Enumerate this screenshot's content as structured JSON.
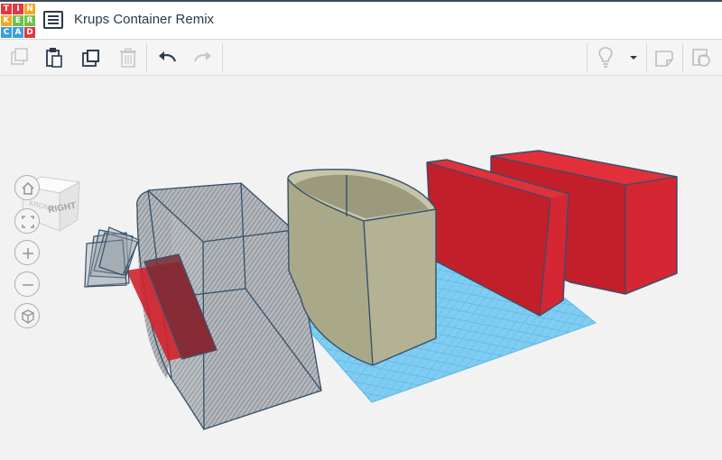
{
  "app": {
    "logo_letters": [
      "T",
      "I",
      "N",
      "K",
      "E",
      "R",
      "C",
      "A",
      "D"
    ],
    "logo_colors": [
      "#e2383f",
      "#e2383f",
      "#f5a623",
      "#f5a623",
      "#6fc04b",
      "#6fc04b",
      "#3d9fd9",
      "#3d9fd9",
      "#e2383f"
    ],
    "design_title": "Krups Container Remix",
    "design_list_icon": "list-icon"
  },
  "toolbar": {
    "buttons": [
      {
        "name": "copy",
        "icon": "copy-icon",
        "enabled": false
      },
      {
        "name": "paste",
        "icon": "paste-icon",
        "enabled": true
      },
      {
        "name": "duplicate",
        "icon": "duplicate-icon",
        "enabled": true
      },
      {
        "name": "delete",
        "icon": "trash-icon",
        "enabled": false
      },
      {
        "name": "undo",
        "icon": "undo-arrow-icon",
        "enabled": true
      },
      {
        "name": "redo",
        "icon": "redo-arrow-icon",
        "enabled": false
      },
      {
        "name": "light",
        "icon": "lightbulb-icon",
        "enabled": false
      },
      {
        "name": "light-menu",
        "icon": "caret-down-icon",
        "enabled": true
      },
      {
        "name": "note",
        "icon": "note-icon",
        "enabled": false
      },
      {
        "name": "ruler",
        "icon": "ruler-icon",
        "enabled": false
      }
    ]
  },
  "viewcube": {
    "front_label": "RIGHT",
    "side_label": "FRONT"
  },
  "nav_controls": [
    {
      "name": "home-view",
      "icon": "home-icon"
    },
    {
      "name": "fit-all",
      "icon": "fit-frame-icon"
    },
    {
      "name": "zoom-in",
      "icon": "plus-icon"
    },
    {
      "name": "zoom-out",
      "icon": "minus-icon"
    },
    {
      "name": "ortho-toggle",
      "icon": "cube-icon"
    }
  ],
  "colors": {
    "hole": "#8f959b",
    "workplane": "#6fc6ef",
    "container": "#a9a98a",
    "red": "#d0222d",
    "outline": "#34506a"
  }
}
